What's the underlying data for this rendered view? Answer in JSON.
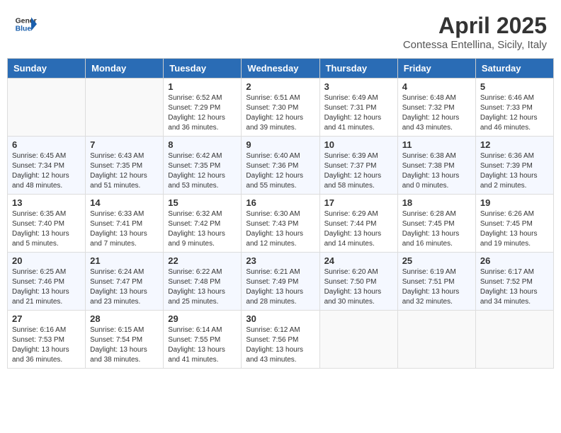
{
  "header": {
    "logo_line1": "General",
    "logo_line2": "Blue",
    "month": "April 2025",
    "location": "Contessa Entellina, Sicily, Italy"
  },
  "weekdays": [
    "Sunday",
    "Monday",
    "Tuesday",
    "Wednesday",
    "Thursday",
    "Friday",
    "Saturday"
  ],
  "weeks": [
    [
      {
        "day": "",
        "info": ""
      },
      {
        "day": "",
        "info": ""
      },
      {
        "day": "1",
        "info": "Sunrise: 6:52 AM\nSunset: 7:29 PM\nDaylight: 12 hours and 36 minutes."
      },
      {
        "day": "2",
        "info": "Sunrise: 6:51 AM\nSunset: 7:30 PM\nDaylight: 12 hours and 39 minutes."
      },
      {
        "day": "3",
        "info": "Sunrise: 6:49 AM\nSunset: 7:31 PM\nDaylight: 12 hours and 41 minutes."
      },
      {
        "day": "4",
        "info": "Sunrise: 6:48 AM\nSunset: 7:32 PM\nDaylight: 12 hours and 43 minutes."
      },
      {
        "day": "5",
        "info": "Sunrise: 6:46 AM\nSunset: 7:33 PM\nDaylight: 12 hours and 46 minutes."
      }
    ],
    [
      {
        "day": "6",
        "info": "Sunrise: 6:45 AM\nSunset: 7:34 PM\nDaylight: 12 hours and 48 minutes."
      },
      {
        "day": "7",
        "info": "Sunrise: 6:43 AM\nSunset: 7:35 PM\nDaylight: 12 hours and 51 minutes."
      },
      {
        "day": "8",
        "info": "Sunrise: 6:42 AM\nSunset: 7:35 PM\nDaylight: 12 hours and 53 minutes."
      },
      {
        "day": "9",
        "info": "Sunrise: 6:40 AM\nSunset: 7:36 PM\nDaylight: 12 hours and 55 minutes."
      },
      {
        "day": "10",
        "info": "Sunrise: 6:39 AM\nSunset: 7:37 PM\nDaylight: 12 hours and 58 minutes."
      },
      {
        "day": "11",
        "info": "Sunrise: 6:38 AM\nSunset: 7:38 PM\nDaylight: 13 hours and 0 minutes."
      },
      {
        "day": "12",
        "info": "Sunrise: 6:36 AM\nSunset: 7:39 PM\nDaylight: 13 hours and 2 minutes."
      }
    ],
    [
      {
        "day": "13",
        "info": "Sunrise: 6:35 AM\nSunset: 7:40 PM\nDaylight: 13 hours and 5 minutes."
      },
      {
        "day": "14",
        "info": "Sunrise: 6:33 AM\nSunset: 7:41 PM\nDaylight: 13 hours and 7 minutes."
      },
      {
        "day": "15",
        "info": "Sunrise: 6:32 AM\nSunset: 7:42 PM\nDaylight: 13 hours and 9 minutes."
      },
      {
        "day": "16",
        "info": "Sunrise: 6:30 AM\nSunset: 7:43 PM\nDaylight: 13 hours and 12 minutes."
      },
      {
        "day": "17",
        "info": "Sunrise: 6:29 AM\nSunset: 7:44 PM\nDaylight: 13 hours and 14 minutes."
      },
      {
        "day": "18",
        "info": "Sunrise: 6:28 AM\nSunset: 7:45 PM\nDaylight: 13 hours and 16 minutes."
      },
      {
        "day": "19",
        "info": "Sunrise: 6:26 AM\nSunset: 7:45 PM\nDaylight: 13 hours and 19 minutes."
      }
    ],
    [
      {
        "day": "20",
        "info": "Sunrise: 6:25 AM\nSunset: 7:46 PM\nDaylight: 13 hours and 21 minutes."
      },
      {
        "day": "21",
        "info": "Sunrise: 6:24 AM\nSunset: 7:47 PM\nDaylight: 13 hours and 23 minutes."
      },
      {
        "day": "22",
        "info": "Sunrise: 6:22 AM\nSunset: 7:48 PM\nDaylight: 13 hours and 25 minutes."
      },
      {
        "day": "23",
        "info": "Sunrise: 6:21 AM\nSunset: 7:49 PM\nDaylight: 13 hours and 28 minutes."
      },
      {
        "day": "24",
        "info": "Sunrise: 6:20 AM\nSunset: 7:50 PM\nDaylight: 13 hours and 30 minutes."
      },
      {
        "day": "25",
        "info": "Sunrise: 6:19 AM\nSunset: 7:51 PM\nDaylight: 13 hours and 32 minutes."
      },
      {
        "day": "26",
        "info": "Sunrise: 6:17 AM\nSunset: 7:52 PM\nDaylight: 13 hours and 34 minutes."
      }
    ],
    [
      {
        "day": "27",
        "info": "Sunrise: 6:16 AM\nSunset: 7:53 PM\nDaylight: 13 hours and 36 minutes."
      },
      {
        "day": "28",
        "info": "Sunrise: 6:15 AM\nSunset: 7:54 PM\nDaylight: 13 hours and 38 minutes."
      },
      {
        "day": "29",
        "info": "Sunrise: 6:14 AM\nSunset: 7:55 PM\nDaylight: 13 hours and 41 minutes."
      },
      {
        "day": "30",
        "info": "Sunrise: 6:12 AM\nSunset: 7:56 PM\nDaylight: 13 hours and 43 minutes."
      },
      {
        "day": "",
        "info": ""
      },
      {
        "day": "",
        "info": ""
      },
      {
        "day": "",
        "info": ""
      }
    ]
  ]
}
